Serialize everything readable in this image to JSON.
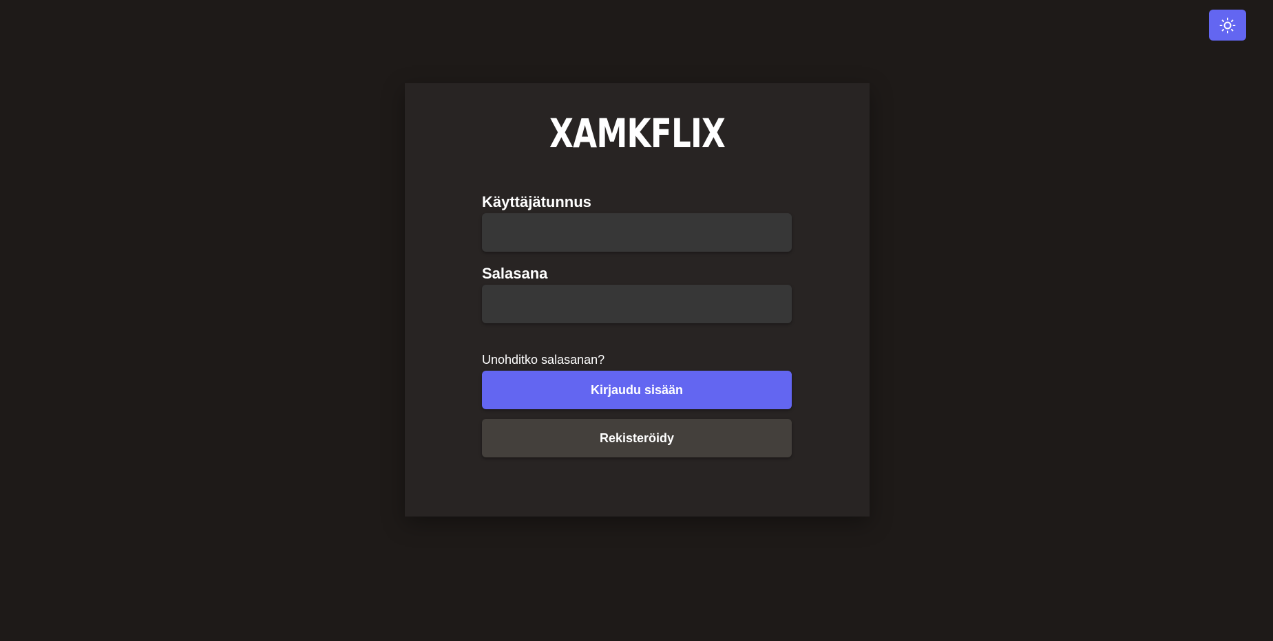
{
  "header": {
    "theme_toggle_icon": "sun-icon"
  },
  "login": {
    "logo_text": "XAMKFLIX",
    "username_label": "Käyttäjätunnus",
    "username_value": "",
    "password_label": "Salasana",
    "password_value": "",
    "forgot_password_link": "Unohditko salasanan?",
    "login_button": "Kirjaudu sisään",
    "register_button": "Rekisteröidy"
  },
  "colors": {
    "page_background": "#1e1a18",
    "card_background": "#282423",
    "accent": "#6366f1",
    "input_background": "#373737",
    "secondary_button": "#44403c",
    "text": "#ffffff"
  }
}
